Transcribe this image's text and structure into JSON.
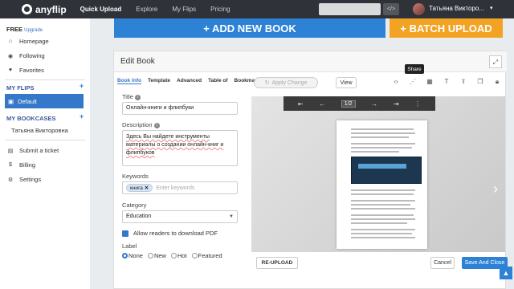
{
  "topbar": {
    "brand": "anyflip",
    "nav": [
      "Quick Upload",
      "Explore",
      "My Flips",
      "Pricing"
    ],
    "active": "Quick Upload",
    "code_label": "</>",
    "user": "Татьяна Викторо...",
    "caret": "▾"
  },
  "sidebar": {
    "plan": "FREE",
    "upgrade": "Upgrade",
    "items": [
      "Homepage",
      "Following",
      "Favorites"
    ],
    "myflips": "MY FLIPS",
    "default": "Default",
    "mybookcases": "MY BOOKCASES",
    "bookcase": "Татьяна Викторовна",
    "extra": [
      "Submit a ticket",
      "Billing",
      "Settings"
    ],
    "plus": "+"
  },
  "buttons": {
    "add": "+ ADD NEW BOOK",
    "batch": "+ BATCH UPLOAD"
  },
  "edit": {
    "title": "Edit Book",
    "tabs": [
      "Book Info",
      "Template",
      "Advanced",
      "Table of",
      "Bookmark"
    ],
    "title_label": "Title",
    "title_value": "Онлайн-книги и флипбуки",
    "desc_label": "Description",
    "desc_value": "Здесь Вы найдете инструменты материалы о создании онлайн-книг и флипбуков",
    "kw_label": "Keywords",
    "kw_tag": "книга",
    "kw_placeholder": "Enter keywords",
    "cat_label": "Category",
    "cat_value": "Education",
    "download": "Allow readers to download PDF",
    "label_label": "Label",
    "radios": [
      "None",
      "New",
      "Hot",
      "Featured"
    ]
  },
  "toolbar": {
    "apply": "Apply Change",
    "view": "View",
    "tooltip": "Share"
  },
  "viewer": {
    "page": "1/2"
  },
  "footer": {
    "reupload": "RE-UPLOAD",
    "cancel": "Cancel",
    "save": "Save And Close"
  },
  "colors": {
    "accent": "#2d82d6",
    "batch": "#f2a323",
    "topbar": "#2f3238"
  }
}
